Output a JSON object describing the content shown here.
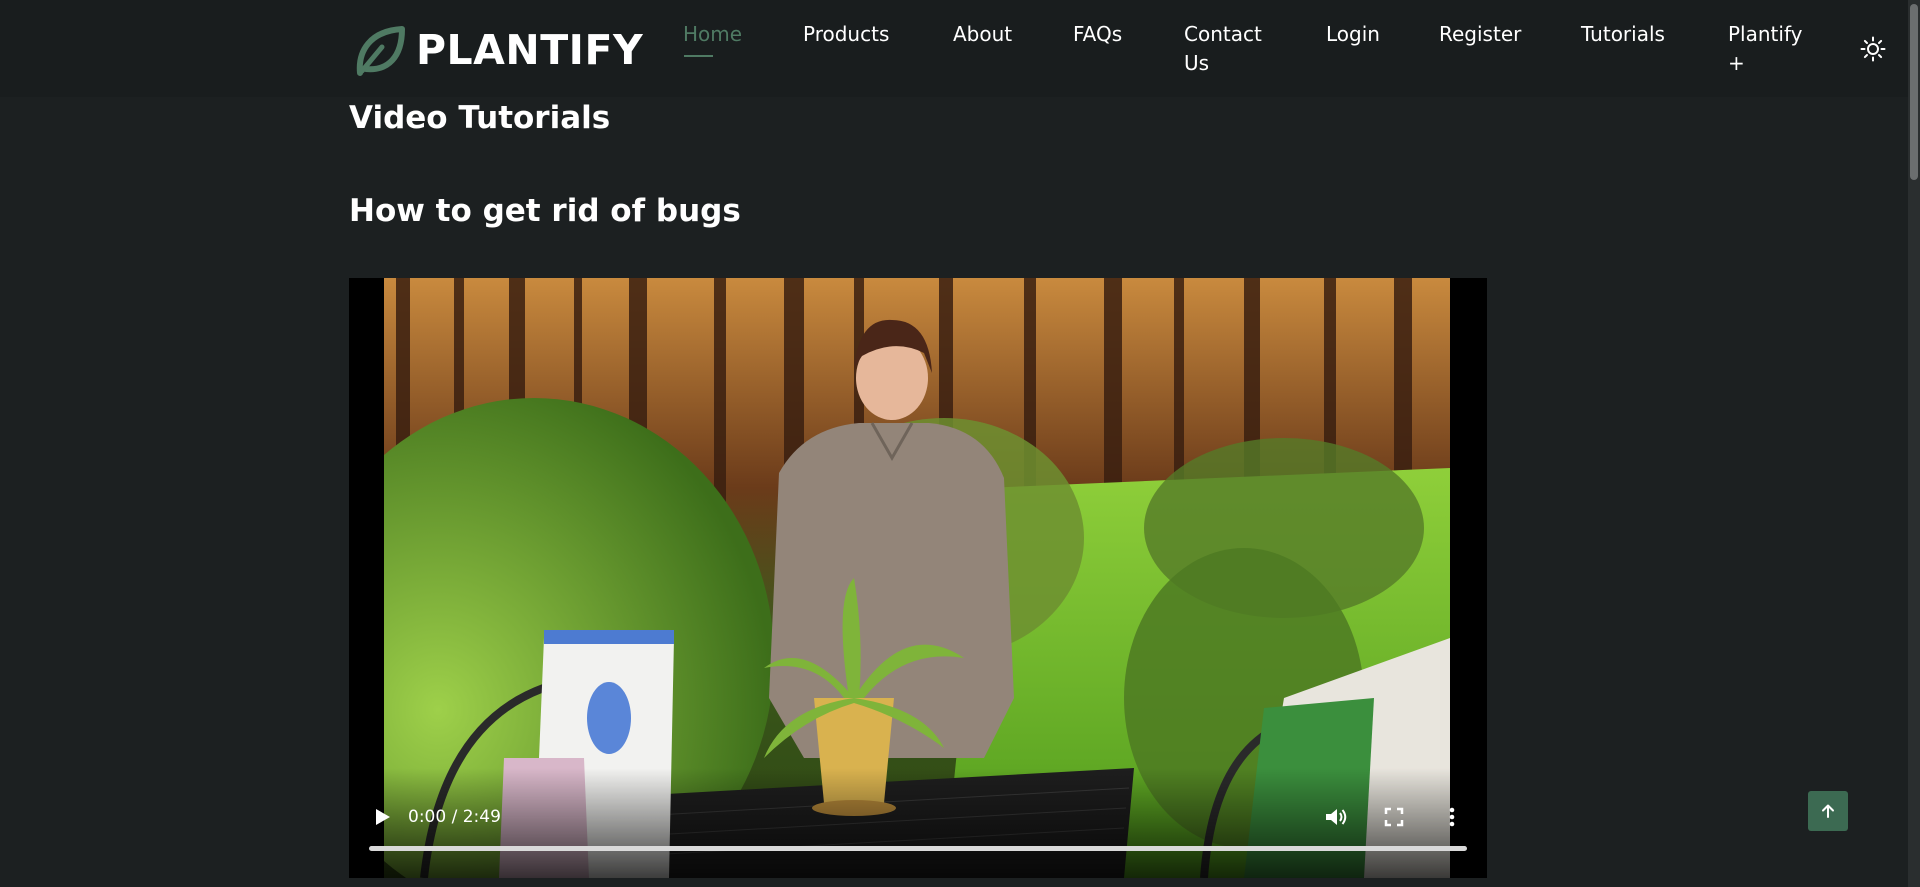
{
  "brand": {
    "name": "PLANTIFY",
    "icon": "leaf-icon",
    "accent": "#4f7a63"
  },
  "nav": {
    "items": [
      {
        "label": "Home",
        "active": true
      },
      {
        "label": "Products"
      },
      {
        "label": "About"
      },
      {
        "label": "FAQs"
      },
      {
        "label": "Contact Us"
      },
      {
        "label": "Login"
      },
      {
        "label": "Register"
      },
      {
        "label": "Tutorials"
      },
      {
        "label": "Plantify +"
      }
    ],
    "theme_toggle_icon": "sun-icon"
  },
  "page": {
    "section_title": "Video Tutorials",
    "video_title": "How to get rid of bugs"
  },
  "video": {
    "time": "0:00 / 2:49",
    "icons": [
      "play-icon",
      "volume-icon",
      "fullscreen-icon",
      "more-options-icon"
    ]
  },
  "back_to_top_icon": "arrow-up-icon"
}
